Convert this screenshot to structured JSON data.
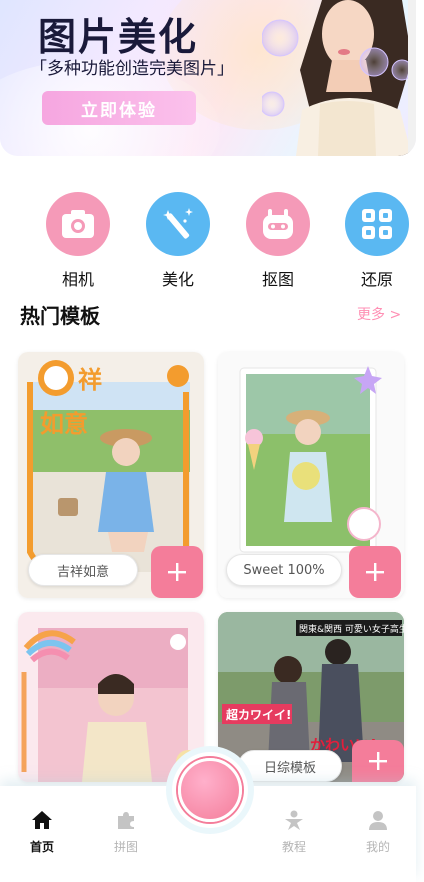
{
  "banner": {
    "title": "图片美化",
    "subtitle": "「多种功能创造完美图片」",
    "cta": "立即体验"
  },
  "tools": [
    {
      "label": "相机",
      "icon": "camera-icon",
      "color": "#f59ab8"
    },
    {
      "label": "美化",
      "icon": "magic-wand-icon",
      "color": "#5ab8f2"
    },
    {
      "label": "抠图",
      "icon": "robot-icon",
      "color": "#f59ab8"
    },
    {
      "label": "还原",
      "icon": "grid-icon",
      "color": "#5ab8f2"
    }
  ],
  "section": {
    "title": "热门模板",
    "more": "更多 >"
  },
  "templates": [
    {
      "name": "吉祥如意",
      "sticker_text": "祥 如意"
    },
    {
      "name": "Sweet 100%"
    },
    {
      "name": ""
    },
    {
      "name": "日综模板",
      "sticker_texts": [
        "関東&関西 可愛い女子高生",
        "超カワイイ!",
        "かわいい!"
      ]
    }
  ],
  "nav": {
    "home": "首页",
    "collage": "拼图",
    "tutorial": "教程",
    "mine": "我的"
  },
  "colors": {
    "accent": "#f47d9a",
    "blue": "#5ab8f2",
    "pink": "#f59ab8"
  }
}
